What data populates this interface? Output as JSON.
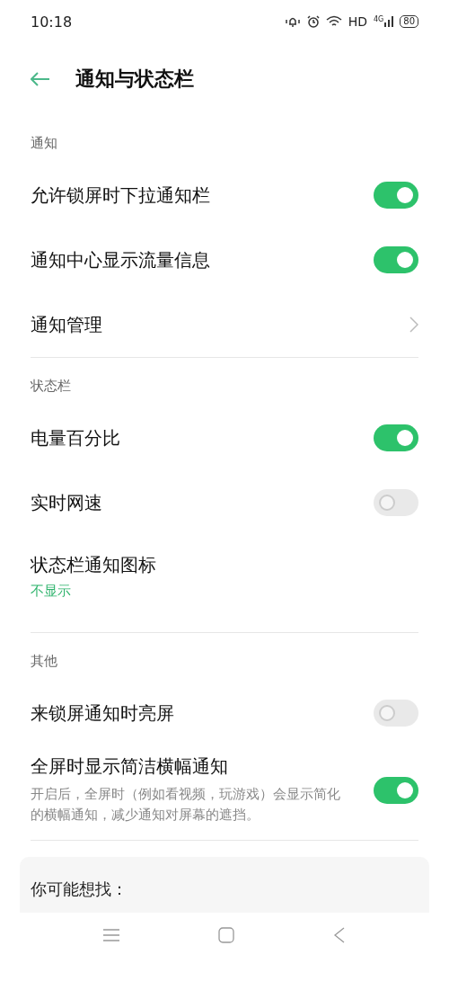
{
  "status_bar": {
    "time": "10:18",
    "network_label": "HD",
    "network_type": "4G",
    "battery": "80"
  },
  "header": {
    "title": "通知与状态栏"
  },
  "sections": [
    {
      "title": "通知",
      "items": [
        {
          "kind": "toggle",
          "label": "允许锁屏时下拉通知栏",
          "on": true
        },
        {
          "kind": "toggle",
          "label": "通知中心显示流量信息",
          "on": true
        },
        {
          "kind": "link",
          "label": "通知管理"
        }
      ]
    },
    {
      "title": "状态栏",
      "items": [
        {
          "kind": "toggle",
          "label": "电量百分比",
          "on": true
        },
        {
          "kind": "toggle",
          "label": "实时网速",
          "on": false
        },
        {
          "kind": "value",
          "label": "状态栏通知图标",
          "value": "不显示"
        }
      ]
    },
    {
      "title": "其他",
      "items": [
        {
          "kind": "toggle",
          "label": "来锁屏通知时亮屏",
          "on": false
        },
        {
          "kind": "toggle",
          "label": "全屏时显示简洁横幅通知",
          "on": true,
          "description": "开启后，全屏时（例如看视频，玩游戏）会显示简化的横幅通知，减少通知对屏幕的遮挡。"
        }
      ]
    }
  ],
  "suggestions": {
    "title": "你可能想找："
  }
}
